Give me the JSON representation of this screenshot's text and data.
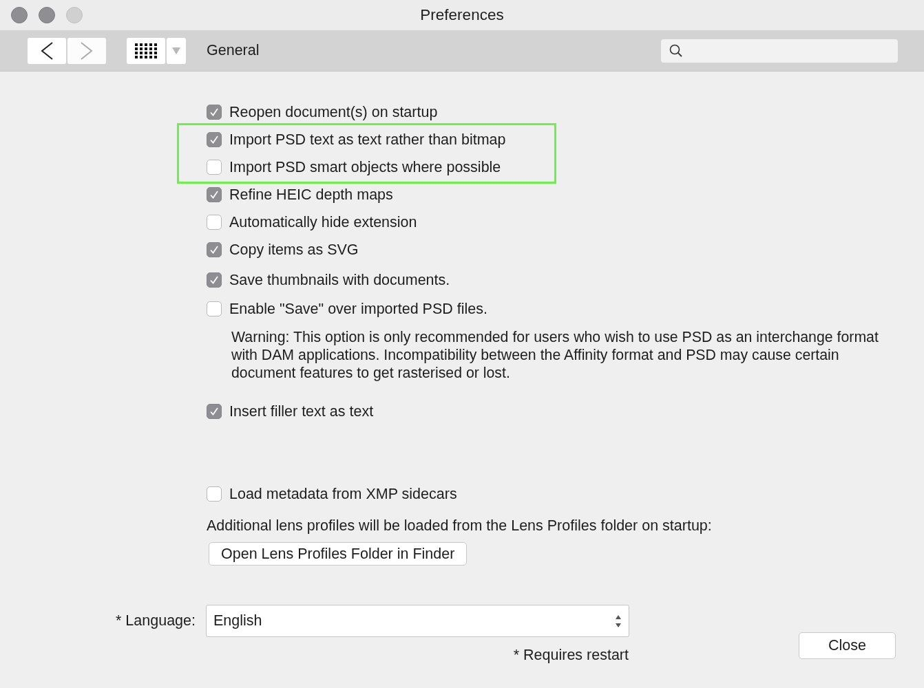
{
  "window": {
    "title": "Preferences"
  },
  "toolbar": {
    "nav": [
      {
        "kind": "back",
        "disabled": false
      },
      {
        "kind": "forward",
        "disabled": true
      }
    ],
    "section": "General"
  },
  "options": [
    {
      "kind": "checkbox",
      "label": "Reopen document(s) on startup",
      "checked": true
    },
    {
      "kind": "group",
      "highlighted": true,
      "items": [
        {
          "label": "Import PSD text as text rather than bitmap",
          "checked": true
        },
        {
          "label": "Import PSD smart objects where possible",
          "checked": false
        }
      ]
    },
    {
      "kind": "checkbox",
      "label": "Refine HEIC depth maps",
      "checked": true
    },
    {
      "kind": "checkbox",
      "label": "Automatically hide extension",
      "checked": false
    },
    {
      "kind": "checkbox",
      "label": "Copy items as SVG",
      "checked": true
    },
    {
      "kind": "checkbox",
      "label": "Save thumbnails with documents.",
      "checked": true
    },
    {
      "kind": "checkbox",
      "label": "Enable \"Save\" over imported PSD files.",
      "checked": false
    },
    {
      "kind": "note",
      "text": "Warning: This option is only recommended for users who wish to use PSD as an interchange format with DAM applications. Incompatibility between the Affinity format and PSD may cause certain document features to get rasterised or lost."
    },
    {
      "kind": "checkbox",
      "label": "Insert filler text as text",
      "checked": true
    },
    {
      "kind": "checkbox",
      "label": "Load metadata from XMP sidecars",
      "checked": false
    },
    {
      "kind": "text",
      "text": "Additional lens profiles will be loaded from the Lens Profiles folder on startup:"
    },
    {
      "kind": "button",
      "label": "Open Lens Profiles Folder in Finder"
    }
  ],
  "language": {
    "label": "* Language:",
    "value": "English",
    "note": "* Requires restart"
  },
  "buttons": [
    "Close"
  ]
}
